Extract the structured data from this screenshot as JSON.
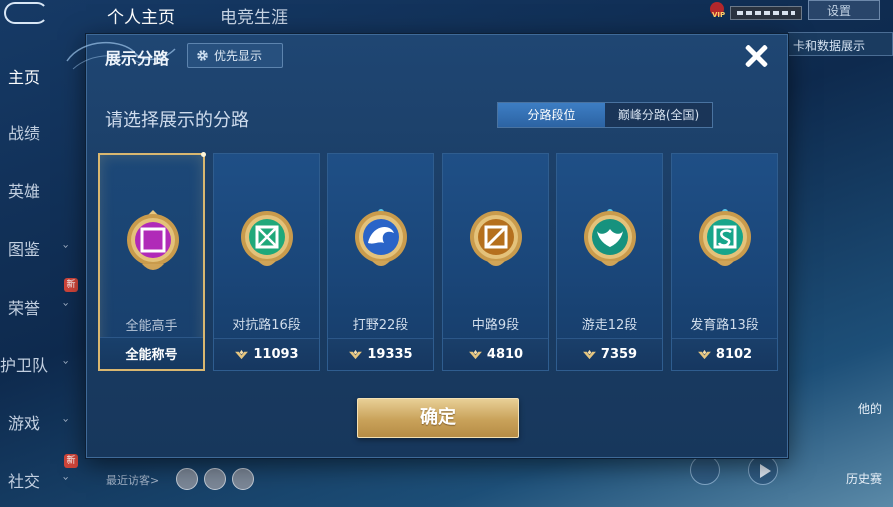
{
  "top_tabs": [
    {
      "label": "个人主页",
      "active": true
    },
    {
      "label": "电竞生涯",
      "active": false
    }
  ],
  "top_right": {
    "vip_badge": "VIP",
    "button_label": "设置",
    "data_button": "卡和数据展示"
  },
  "sidebar": {
    "items": [
      {
        "label": "主页",
        "active": true
      },
      {
        "label": "战绩"
      },
      {
        "label": "英雄"
      },
      {
        "label": "图鉴"
      },
      {
        "label": "荣誉"
      },
      {
        "label": "护卫队"
      },
      {
        "label": "游戏"
      },
      {
        "label": "社交"
      }
    ],
    "new_badge": "新"
  },
  "bottom": {
    "visitors_label": "最近访客>"
  },
  "right_labels": [
    "他的",
    "历史赛"
  ],
  "modal": {
    "title": "展示分路",
    "priority_button": "优先显示",
    "subtitle": "请选择展示的分路",
    "segment": [
      {
        "label": "分路段位",
        "active": true
      },
      {
        "label": "巅峰分路(全国)",
        "active": false
      }
    ],
    "cards": [
      {
        "label": "全能高手",
        "footer": "全能称号",
        "selected": true,
        "emblem": "all-round-emblem-icon",
        "color": "#b02ab8",
        "show_icon": false
      },
      {
        "label": "对抗路16段",
        "footer": "11093",
        "selected": false,
        "emblem": "clash-lane-emblem-icon",
        "color": "#1fa87a",
        "show_icon": true
      },
      {
        "label": "打野22段",
        "footer": "19335",
        "selected": false,
        "emblem": "jungle-emblem-icon",
        "color": "#2a64c8",
        "show_icon": true
      },
      {
        "label": "中路9段",
        "footer": "4810",
        "selected": false,
        "emblem": "mid-lane-emblem-icon",
        "color": "#b5701e",
        "show_icon": true
      },
      {
        "label": "游走12段",
        "footer": "7359",
        "selected": false,
        "emblem": "roam-emblem-icon",
        "color": "#16927e",
        "show_icon": true
      },
      {
        "label": "发育路13段",
        "footer": "8102",
        "selected": false,
        "emblem": "farm-lane-emblem-icon",
        "color": "#17a58a",
        "show_icon": true
      }
    ],
    "confirm_button": "确定"
  }
}
